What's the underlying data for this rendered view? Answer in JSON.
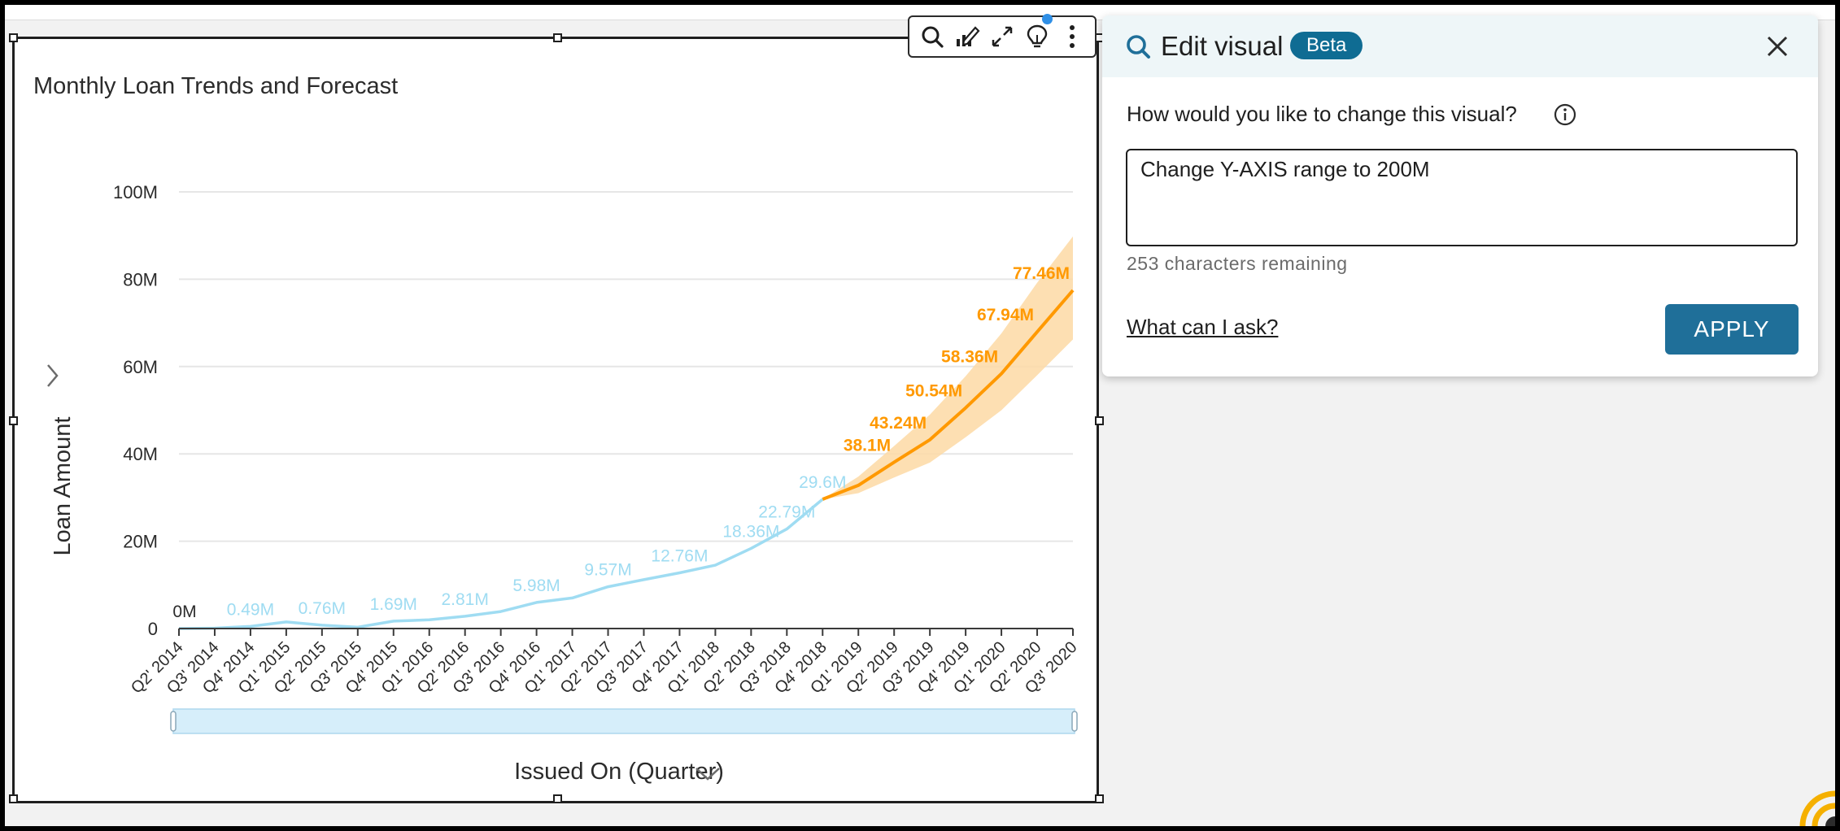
{
  "visual": {
    "title": "Monthly Loan Trends and Forecast",
    "toolbar": {
      "icons": [
        "search-icon",
        "edit-chart-icon",
        "expand-icon",
        "insight-lightbulb-icon",
        "more-options-icon"
      ]
    }
  },
  "chart_data": {
    "type": "line",
    "title": "Monthly Loan Trends and Forecast",
    "xlabel": "Issued On (Quarter)",
    "ylabel": "Loan Amount",
    "ylim": [
      0,
      100
    ],
    "y_unit": "M",
    "y_ticks": [
      "0",
      "20M",
      "40M",
      "60M",
      "80M",
      "100M"
    ],
    "y_tick_values": [
      0,
      20,
      40,
      60,
      80,
      100
    ],
    "grid": true,
    "categories": [
      "Q2' 2014",
      "Q3' 2014",
      "Q4' 2014",
      "Q1' 2015",
      "Q2' 2015",
      "Q3' 2015",
      "Q4' 2015",
      "Q1' 2016",
      "Q2' 2016",
      "Q3' 2016",
      "Q4' 2016",
      "Q1' 2017",
      "Q2' 2017",
      "Q3' 2017",
      "Q4' 2017",
      "Q1' 2018",
      "Q2' 2018",
      "Q3' 2018",
      "Q4' 2018",
      "Q1' 2019",
      "Q2' 2019",
      "Q3' 2019",
      "Q4' 2019",
      "Q1' 2020",
      "Q2' 2020",
      "Q3' 2020"
    ],
    "series": [
      {
        "role": "actual",
        "color": "#9fdcf2",
        "values": [
          0.0,
          0.1,
          0.49,
          1.5,
          0.76,
          0.3,
          1.69,
          2.0,
          2.81,
          3.9,
          5.98,
          7.0,
          9.57,
          11.2,
          12.76,
          14.5,
          18.36,
          22.79,
          29.6,
          null,
          null,
          null,
          null,
          null,
          null,
          null
        ],
        "labels": {
          "0": "0M",
          "2": "0.49M",
          "4": "0.76M",
          "6": "1.69M",
          "8": "2.81M",
          "10": "5.98M",
          "12": "9.57M",
          "14": "12.76M",
          "16": "18.36M",
          "17": "22.79M",
          "18": "29.6M"
        }
      },
      {
        "role": "forecast",
        "color": "#ff9900",
        "values": [
          null,
          null,
          null,
          null,
          null,
          null,
          null,
          null,
          null,
          null,
          null,
          null,
          null,
          null,
          null,
          null,
          null,
          null,
          29.6,
          32.8,
          38.1,
          43.24,
          50.54,
          58.36,
          67.94,
          77.46
        ],
        "labels": {
          "20": "38.1M",
          "21": "43.24M",
          "22": "50.54M",
          "23": "58.36M",
          "24": "67.94M",
          "25": "77.46M"
        },
        "band_upper": [
          null,
          null,
          null,
          null,
          null,
          null,
          null,
          null,
          null,
          null,
          null,
          null,
          null,
          null,
          null,
          null,
          null,
          null,
          29.6,
          34.8,
          41.8,
          49.0,
          57.8,
          67.6,
          79.2,
          89.8
        ],
        "band_lower": [
          null,
          null,
          null,
          null,
          null,
          null,
          null,
          null,
          null,
          null,
          null,
          null,
          null,
          null,
          null,
          null,
          null,
          null,
          29.6,
          31.0,
          34.6,
          38.0,
          43.8,
          50.0,
          58.0,
          66.2
        ]
      }
    ]
  },
  "edit_panel": {
    "title": "Edit visual",
    "badge": "Beta",
    "prompt_label": "How would you like to change this visual?",
    "prompt_value": "Change Y-AXIS range to 200M",
    "char_counter": "253 characters remaining",
    "help_link": "What can I ask?",
    "apply_label": "APPLY"
  },
  "colors": {
    "actual_line": "#9fdcf2",
    "forecast_line": "#ff9900",
    "forecast_band": "#fdd9a4",
    "apply_button": "#1f6f99",
    "beta_badge": "#0f6c93",
    "panel_header": "#eef6f8"
  }
}
